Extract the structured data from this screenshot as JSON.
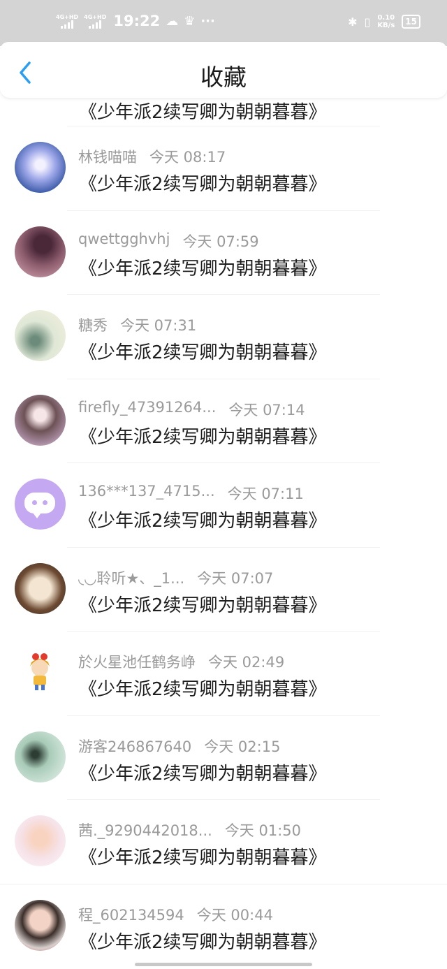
{
  "status_bar": {
    "net1": "4G+HD",
    "net2": "4G+HD",
    "time": "19:22",
    "cloud_icon": "☁",
    "crown_icon": "♛",
    "more": "···",
    "bluetooth_icon": "✱",
    "vibrate_icon": "▯",
    "speed_value": "0.10",
    "speed_unit": "KB/s",
    "battery": "15"
  },
  "header": {
    "title": "收藏"
  },
  "favorites": [
    {
      "name": "",
      "time": "",
      "text": "《少年派2续写卿为朝朝暮暮》"
    },
    {
      "name": "林钱喵喵",
      "time": "今天 08:17",
      "text": "《少年派2续写卿为朝朝暮暮》"
    },
    {
      "name": "qwettgghvhj",
      "time": "今天 07:59",
      "text": "《少年派2续写卿为朝朝暮暮》"
    },
    {
      "name": "糖秀",
      "time": "今天 07:31",
      "text": "《少年派2续写卿为朝朝暮暮》"
    },
    {
      "name": "firefly_47391264...",
      "time": "今天 07:14",
      "text": "《少年派2续写卿为朝朝暮暮》"
    },
    {
      "name": "136***137_4715...",
      "time": "今天 07:11",
      "text": "《少年派2续写卿为朝朝暮暮》"
    },
    {
      "name": "◟◡聆听★、_1...",
      "time": "今天 07:07",
      "text": "《少年派2续写卿为朝朝暮暮》"
    },
    {
      "name": "於火星池任鹤务峥",
      "time": "今天 02:49",
      "text": "《少年派2续写卿为朝朝暮暮》"
    },
    {
      "name": "游客246867640",
      "time": "今天 02:15",
      "text": "《少年派2续写卿为朝朝暮暮》"
    },
    {
      "name": "茜._9290442018...",
      "time": "今天 01:50",
      "text": "《少年派2续写卿为朝朝暮暮》"
    },
    {
      "name": "程_602134594",
      "time": "今天 00:44",
      "text": "《少年派2续写卿为朝朝暮暮》"
    }
  ],
  "colors": {
    "accent": "#2a9df4",
    "status_bar_bg": "#d4d4d4",
    "meta_text": "#9a9a9a"
  }
}
